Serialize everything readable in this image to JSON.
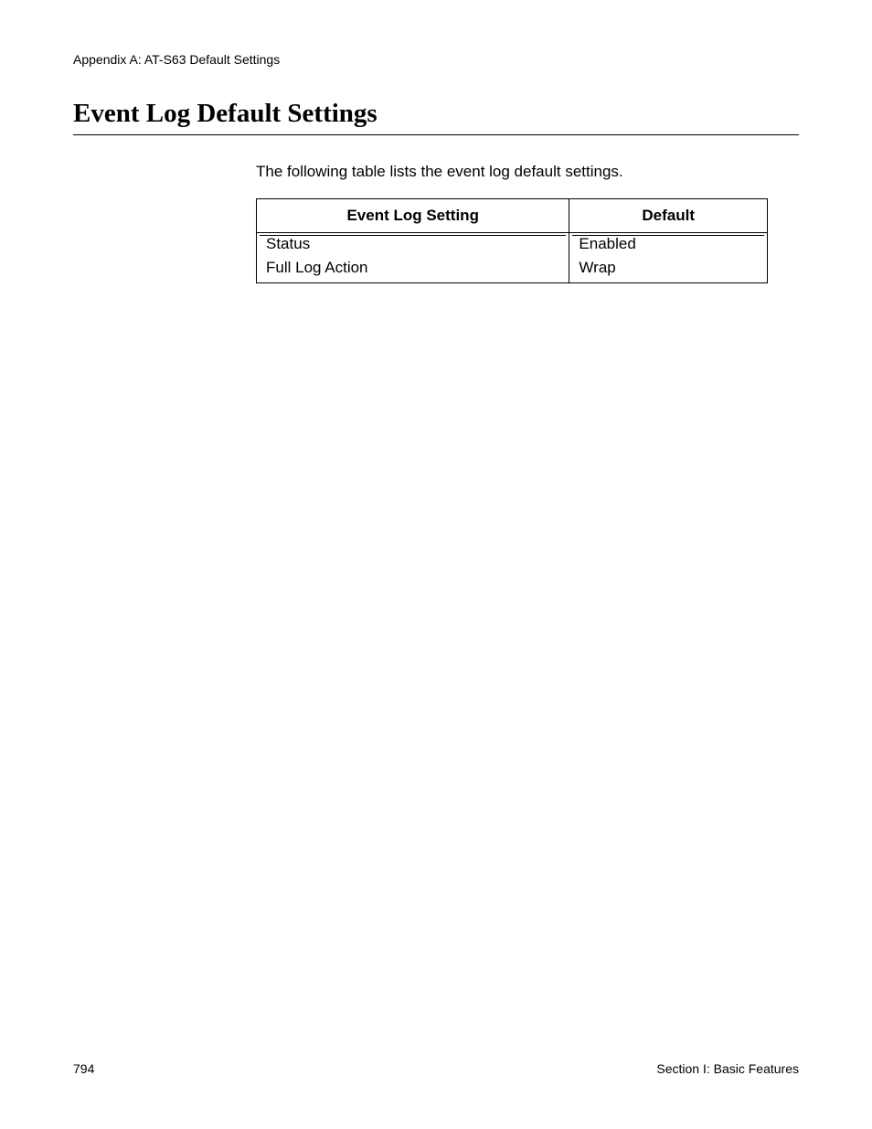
{
  "header": {
    "appendix_label": "Appendix A: AT-S63 Default Settings"
  },
  "title": "Event Log Default Settings",
  "intro": "The following table lists the event log default settings.",
  "table": {
    "headers": {
      "setting": "Event Log Setting",
      "default": "Default"
    },
    "rows": [
      {
        "setting": "Status",
        "default": "Enabled"
      },
      {
        "setting": "Full Log Action",
        "default": "Wrap"
      }
    ]
  },
  "footer": {
    "page_number": "794",
    "section_label": "Section I: Basic Features"
  }
}
